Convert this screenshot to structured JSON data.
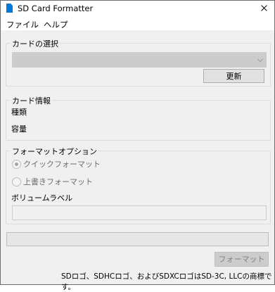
{
  "window": {
    "title": "SD Card Formatter"
  },
  "menu": {
    "items": [
      "ファイル",
      "ヘルプ"
    ]
  },
  "card_select": {
    "group_label": "カードの選択",
    "selected_value": "",
    "refresh_label": "更新"
  },
  "card_info": {
    "group_label": "カード情報",
    "type_label": "種類",
    "capacity_label": "容量"
  },
  "format_options": {
    "group_label": "フォーマットオプション",
    "quick_label": "クイックフォーマット",
    "quick_checked": true,
    "overwrite_label": "上書きフォーマット",
    "overwrite_checked": false,
    "volume_label": "ボリュームラベル",
    "volume_value": ""
  },
  "progress": {
    "value": 0
  },
  "format_button_label": "フォーマット",
  "footer_note": "SDロゴ、SDHCロゴ、およびSDXCロゴはSD-3C, LLCの商標です。",
  "colors": {
    "app_icon": "#0078d7",
    "window_bg": "#f0f0f0"
  },
  "icons": {
    "app": "sd-card-icon",
    "close": "close-icon",
    "dropdown": "chevron-down-icon"
  }
}
